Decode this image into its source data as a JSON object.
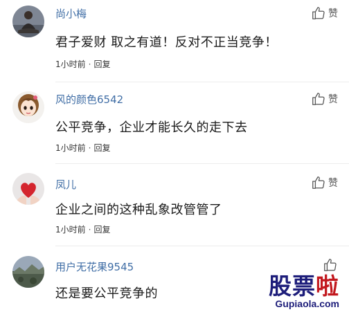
{
  "like_label": "赞",
  "comments": [
    {
      "username": "尚小梅",
      "avatar_icon": "user-avatar-meditation",
      "content": "君子爱财 取之有道！反对不正当竞争！",
      "time": "1小时前",
      "separator": "·",
      "reply_label": "回复"
    },
    {
      "username": "风的颜色6542",
      "avatar_icon": "user-avatar-cartoon-girl",
      "content": "公平竞争，企业才能长久的走下去",
      "time": "1小时前",
      "separator": "·",
      "reply_label": "回复"
    },
    {
      "username": "凤儿",
      "avatar_icon": "user-avatar-red-heart",
      "content": "企业之间的这种乱象改管管了",
      "time": "1小时前",
      "separator": "·",
      "reply_label": "回复"
    },
    {
      "username": "用户无花果9545",
      "avatar_icon": "user-avatar-landscape",
      "content": "还是要公平竞争的",
      "time": "",
      "separator": "",
      "reply_label": ""
    }
  ],
  "watermark": {
    "char1": "股",
    "char2": "票",
    "char3": "啦",
    "url": "Gupiaola.com"
  },
  "colors": {
    "username": "#3f6da5",
    "content": "#1a1a1a",
    "meta": "#333333",
    "watermark_blue": "#1d1d7a",
    "watermark_red": "#c2181e"
  }
}
